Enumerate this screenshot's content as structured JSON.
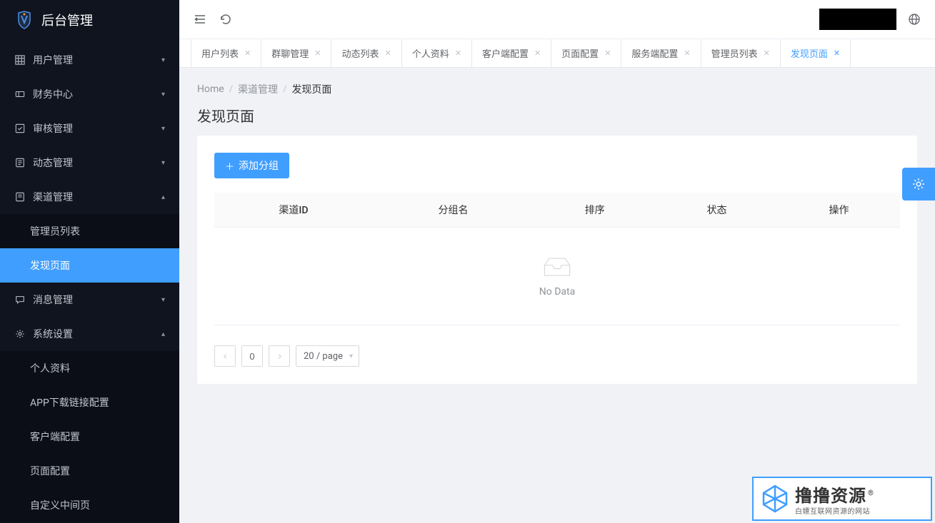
{
  "brand": {
    "title": "后台管理"
  },
  "sidebar": {
    "items": [
      {
        "label": "用户管理",
        "icon": "grid",
        "expanded": false
      },
      {
        "label": "财务中心",
        "icon": "ticket",
        "expanded": false
      },
      {
        "label": "审核管理",
        "icon": "check-square",
        "expanded": false
      },
      {
        "label": "动态管理",
        "icon": "doc",
        "expanded": false
      },
      {
        "label": "渠道管理",
        "icon": "doc",
        "expanded": true,
        "children": [
          {
            "label": "管理员列表",
            "active": false
          },
          {
            "label": "发现页面",
            "active": true
          }
        ]
      },
      {
        "label": "消息管理",
        "icon": "chat",
        "expanded": false
      },
      {
        "label": "系统设置",
        "icon": "gear",
        "expanded": true,
        "children": [
          {
            "label": "个人资料",
            "active": false
          },
          {
            "label": "APP下载链接配置",
            "active": false
          },
          {
            "label": "客户端配置",
            "active": false
          },
          {
            "label": "页面配置",
            "active": false
          },
          {
            "label": "自定义中间页",
            "active": false
          }
        ]
      }
    ]
  },
  "tabs": [
    {
      "label": "用户列表",
      "active": false
    },
    {
      "label": "群聊管理",
      "active": false
    },
    {
      "label": "动态列表",
      "active": false
    },
    {
      "label": "个人资料",
      "active": false
    },
    {
      "label": "客户端配置",
      "active": false
    },
    {
      "label": "页面配置",
      "active": false
    },
    {
      "label": "服务端配置",
      "active": false
    },
    {
      "label": "管理员列表",
      "active": false
    },
    {
      "label": "发现页面",
      "active": true
    }
  ],
  "breadcrumb": [
    {
      "label": "Home",
      "current": false
    },
    {
      "label": "渠道管理",
      "current": false
    },
    {
      "label": "发现页面",
      "current": true
    }
  ],
  "page_title": "发现页面",
  "actions": {
    "add_group_label": "添加分组"
  },
  "table": {
    "columns": [
      "渠道ID",
      "分组名",
      "排序",
      "状态",
      "操作"
    ],
    "rows": [],
    "empty_text": "No Data"
  },
  "pagination": {
    "current_page": "0",
    "page_size_label": "20 / page"
  },
  "watermark": {
    "title": "撸撸资源",
    "subtitle": "白嫖互联网资源的网站",
    "reg_mark": "®"
  }
}
